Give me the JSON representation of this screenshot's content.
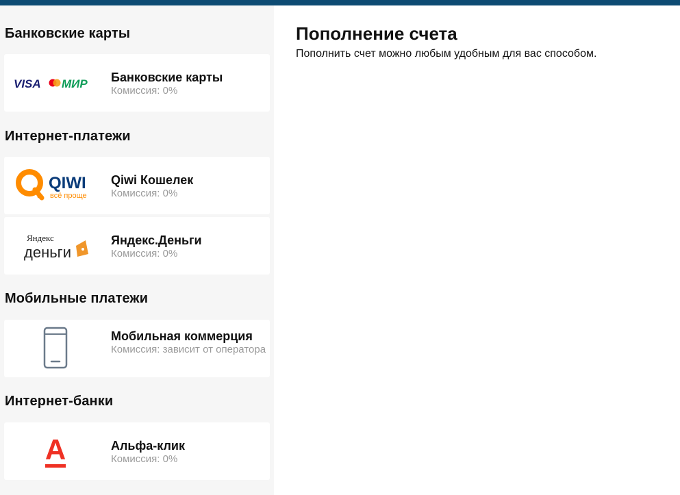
{
  "main": {
    "title": "Пополнение счета",
    "subtitle": "Пополнить счет можно любым удобным для вас способом."
  },
  "sections": [
    {
      "title": "Банковские карты",
      "methods": [
        {
          "name": "Банковские карты",
          "fee": "Комиссия: 0%",
          "logo": {
            "visa": "VISA",
            "mir": "МИР",
            "icon": "visa-mir-logo"
          }
        }
      ]
    },
    {
      "title": "Интернет-платежи",
      "methods": [
        {
          "name": "Qiwi Кошелек",
          "fee": "Комиссия: 0%",
          "logo": {
            "brand": "QIWI",
            "tagline": "всё проще",
            "icon": "qiwi-logo"
          }
        },
        {
          "name": "Яндекс.Деньги",
          "fee": "Комиссия: 0%",
          "logo": {
            "top": "Яндекс",
            "bottom": "деньги",
            "icon": "yandex-money-logo"
          }
        }
      ]
    },
    {
      "title": "Мобильные платежи",
      "methods": [
        {
          "name": "Мобильная коммерция",
          "fee": "Комиссия: зависит от оператора",
          "logo": {
            "icon": "mobile-phone-icon"
          }
        }
      ]
    },
    {
      "title": "Интернет-банки",
      "methods": [
        {
          "name": "Альфа-клик",
          "fee": "Комиссия: 0%",
          "logo": {
            "letter": "А",
            "icon": "alfa-bank-logo"
          }
        }
      ]
    }
  ],
  "colors": {
    "topbar": "#0d4b73",
    "sidebar_bg": "#f6f6f6",
    "fee_text": "#9a9a9a",
    "visa_blue": "#1a1f71",
    "mir_green": "#0f9d58",
    "qiwi_orange": "#ff8c00",
    "qiwi_blue": "#0b3c7a",
    "yandex_orange": "#f0962a",
    "alfa_red": "#ef3124",
    "phone_gray": "#6b7a8a"
  }
}
